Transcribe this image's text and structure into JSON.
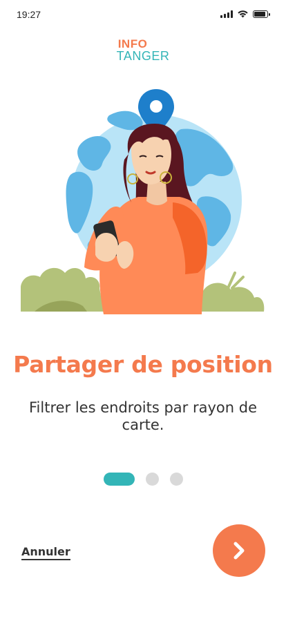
{
  "status_bar": {
    "time": "19:27",
    "icons": [
      "signal-icon",
      "wifi-icon",
      "battery-icon"
    ]
  },
  "logo": {
    "line1": "INFO",
    "line2": "TANGER"
  },
  "onboarding": {
    "title": "Partager de position",
    "description": "Filtrer les endroits par rayon de carte.",
    "illustration": "woman-with-phone-and-globe-with-location-pin",
    "pages_total": 3,
    "current_page": 1
  },
  "actions": {
    "cancel_label": "Annuler",
    "next_icon": "chevron-right-icon"
  },
  "colors": {
    "accent_orange": "#f47a4d",
    "accent_teal": "#33b5b7",
    "inactive_dot": "#d9d9d9",
    "text": "#333333"
  }
}
